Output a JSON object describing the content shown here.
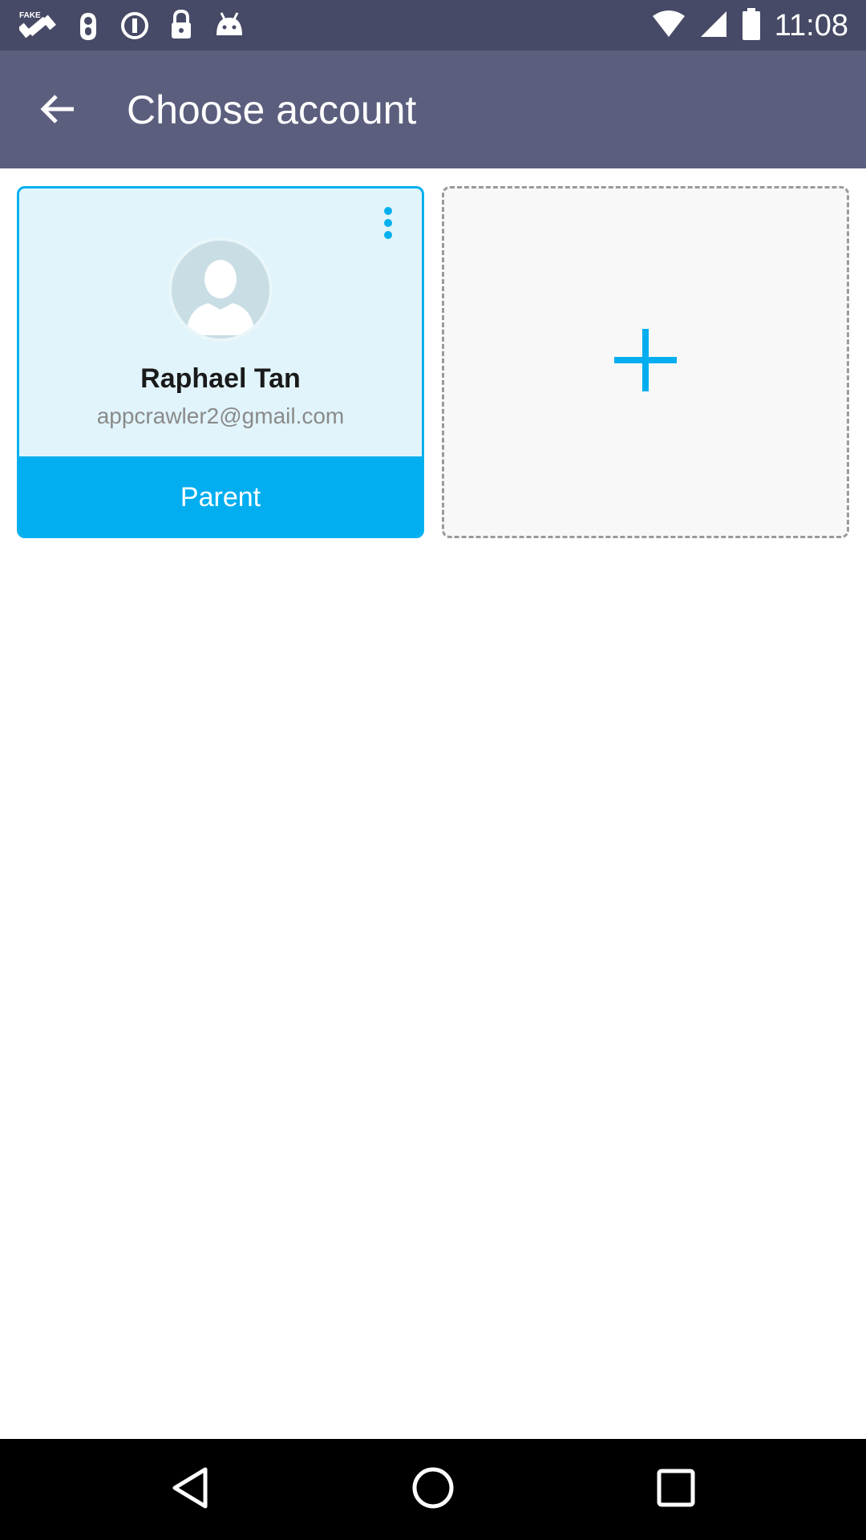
{
  "status_bar": {
    "time": "11:08",
    "icons": [
      "fake-gps-icon",
      "hand-icon",
      "info-circle-icon",
      "lock-icon",
      "android-icon",
      "wifi-icon",
      "signal-icon",
      "battery-icon"
    ]
  },
  "app_bar": {
    "title": "Choose account",
    "back_icon": "arrow-back-icon"
  },
  "accounts": [
    {
      "name": "Raphael Tan",
      "email": "appcrawler2@gmail.com",
      "role_label": "Parent",
      "avatar_icon": "person-avatar-icon",
      "menu_icon": "more-vertical-icon"
    }
  ],
  "add_account": {
    "icon": "plus-icon"
  },
  "nav_bar": {
    "icons": [
      "back-triangle-icon",
      "home-circle-icon",
      "recents-square-icon"
    ]
  },
  "colors": {
    "status_bar": "#474a66",
    "app_bar": "#5b5e7d",
    "accent": "#03aef0",
    "card_bg": "#e1f4fb",
    "add_card_bg": "#f8f8f8"
  }
}
